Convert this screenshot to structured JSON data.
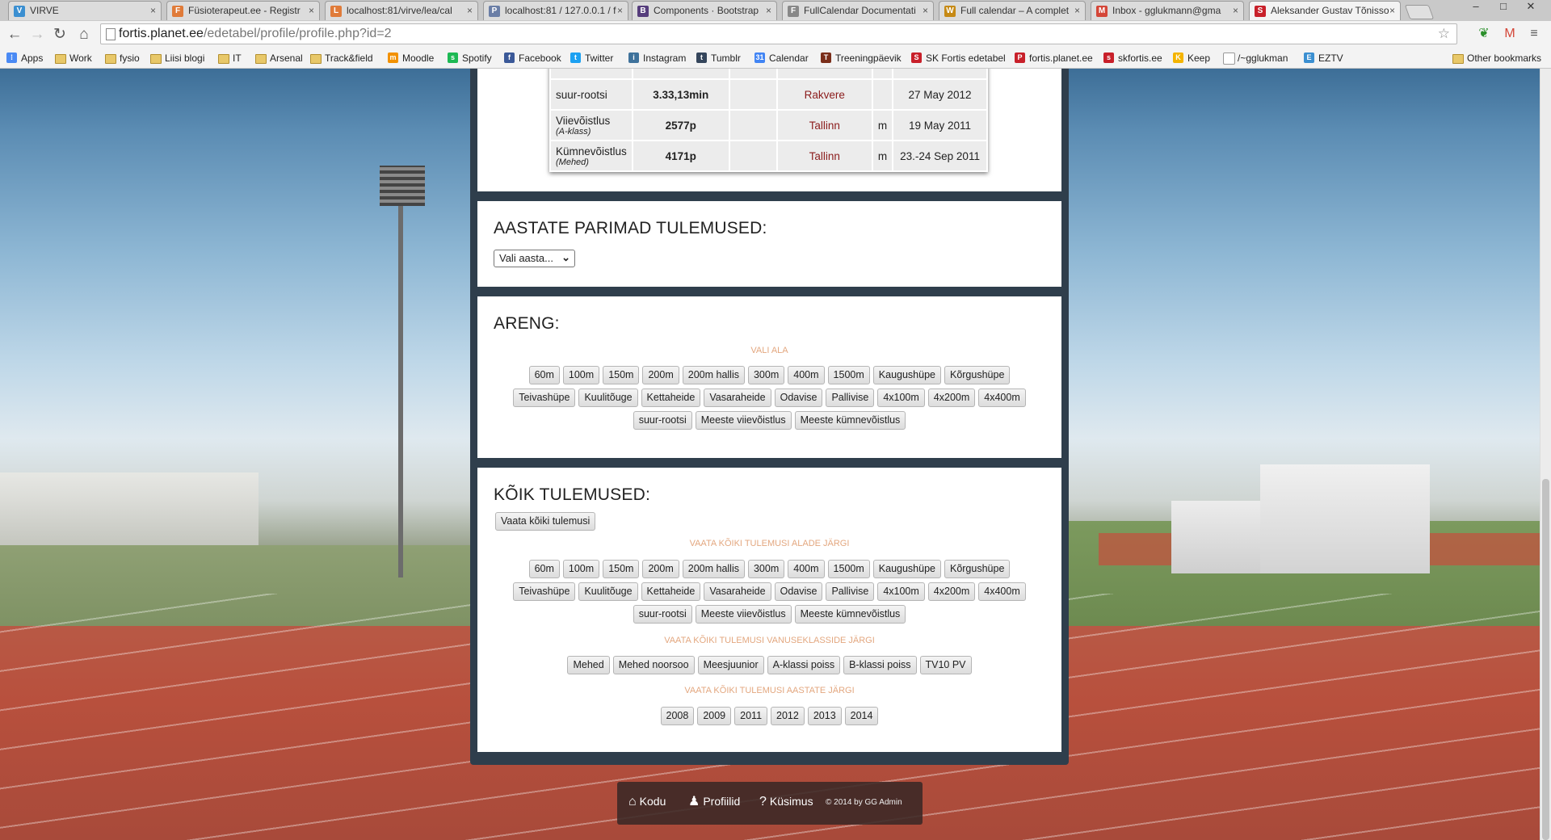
{
  "browser": {
    "tabs": [
      {
        "title": "VIRVE",
        "icon_color": "#3b8fd1",
        "icon": "V",
        "active": false
      },
      {
        "title": "Füsioterapeut.ee - Registr",
        "icon_color": "#e07b39",
        "icon": "F",
        "active": false
      },
      {
        "title": "localhost:81/virve/lea/cal",
        "icon_color": "#e07b39",
        "icon": "L",
        "active": false
      },
      {
        "title": "localhost:81 / 127.0.0.1 / f",
        "icon_color": "#6a7ea6",
        "icon": "P",
        "active": false
      },
      {
        "title": "Components · Bootstrap",
        "icon_color": "#563d7c",
        "icon": "B",
        "active": false
      },
      {
        "title": "FullCalendar Documentati",
        "icon_color": "#888888",
        "icon": "F",
        "active": false
      },
      {
        "title": "Full calendar – A complet",
        "icon_color": "#c68a16",
        "icon": "W",
        "active": false
      },
      {
        "title": "Inbox - gglukmann@gma",
        "icon_color": "#d44638",
        "icon": "M",
        "active": false
      },
      {
        "title": "Aleksander Gustav Tõnisso",
        "icon_color": "#c8202a",
        "icon": "S",
        "active": true
      }
    ],
    "address": {
      "host": "fortis.planet.ee",
      "path": "/edetabel/profile/profile.php?id=2"
    },
    "bookmarks": [
      {
        "label": "Apps",
        "type": "apps"
      },
      {
        "label": "Work",
        "type": "folder"
      },
      {
        "label": "fysio",
        "type": "folder"
      },
      {
        "label": "Liisi blogi",
        "type": "folder"
      },
      {
        "label": "IT",
        "type": "folder"
      },
      {
        "label": "Arsenal",
        "type": "folder"
      },
      {
        "label": "Track&field",
        "type": "folder"
      },
      {
        "label": "Moodle",
        "type": "site",
        "color": "#f29100",
        "icon": "m"
      },
      {
        "label": "Spotify",
        "type": "site",
        "color": "#1db954",
        "icon": "s"
      },
      {
        "label": "Facebook",
        "type": "site",
        "color": "#3b5998",
        "icon": "f"
      },
      {
        "label": "Twitter",
        "type": "site",
        "color": "#1da1f2",
        "icon": "t"
      },
      {
        "label": "Instagram",
        "type": "site",
        "color": "#3f729b",
        "icon": "i"
      },
      {
        "label": "Tumblr",
        "type": "site",
        "color": "#35465c",
        "icon": "t"
      },
      {
        "label": "Calendar",
        "type": "site",
        "color": "#4285f4",
        "icon": "31"
      },
      {
        "label": "Treeningpäevik",
        "type": "site",
        "color": "#7a2e1a",
        "icon": "T"
      },
      {
        "label": "SK Fortis edetabel",
        "type": "site",
        "color": "#c8202a",
        "icon": "S"
      },
      {
        "label": "fortis.planet.ee",
        "type": "site",
        "color": "#c8202a",
        "icon": "P"
      },
      {
        "label": "skfortis.ee",
        "type": "site",
        "color": "#c8202a",
        "icon": "s"
      },
      {
        "label": "Keep",
        "type": "site",
        "color": "#f4b400",
        "icon": "K"
      },
      {
        "label": "/~gglukman",
        "type": "page"
      },
      {
        "label": "EZTV",
        "type": "site",
        "color": "#3b8fd1",
        "icon": "E"
      }
    ],
    "other_bookmarks": "Other bookmarks"
  },
  "results": {
    "rows": [
      {
        "event": "suur-rootsi",
        "sub": "",
        "value": "3.33,13min",
        "place": "Rakvere",
        "m": "",
        "date": "27 May 2012"
      },
      {
        "event": "Viievõistlus",
        "sub": "(A-klass)",
        "value": "2577p",
        "place": "Tallinn",
        "m": "m",
        "date": "19 May 2011"
      },
      {
        "event": "Kümnevõistlus",
        "sub": "(Mehed)",
        "value": "4171p",
        "place": "Tallinn",
        "m": "m",
        "date": "23.-24 Sep 2011"
      }
    ]
  },
  "years_panel": {
    "title": "AASTATE PARIMAD TULEMUSED:",
    "select_value": "Vali aasta..."
  },
  "progress_panel": {
    "title": "ARENG:",
    "label": "VALI ALA",
    "rows": [
      [
        "60m",
        "100m",
        "150m",
        "200m",
        "200m hallis",
        "300m",
        "400m",
        "1500m",
        "Kaugushüpe",
        "Kõrgushüpe"
      ],
      [
        "Teivashüpe",
        "Kuulitõuge",
        "Kettaheide",
        "Vasaraheide",
        "Odavise",
        "Pallivise",
        "4x100m",
        "4x200m",
        "4x400m"
      ],
      [
        "suur-rootsi",
        "Meeste viievõistlus",
        "Meeste kümnevõistlus"
      ]
    ]
  },
  "all_panel": {
    "title": "KÕIK TULEMUSED:",
    "all_button": "Vaata kõiki tulemusi",
    "by_event_label": "VAATA KÕIKI TULEMUSI ALADE JÄRGI",
    "event_rows": [
      [
        "60m",
        "100m",
        "150m",
        "200m",
        "200m hallis",
        "300m",
        "400m",
        "1500m",
        "Kaugushüpe",
        "Kõrgushüpe"
      ],
      [
        "Teivashüpe",
        "Kuulitõuge",
        "Kettaheide",
        "Vasaraheide",
        "Odavise",
        "Pallivise",
        "4x100m",
        "4x200m",
        "4x400m"
      ],
      [
        "suur-rootsi",
        "Meeste viievõistlus",
        "Meeste kümnevõistlus"
      ]
    ],
    "by_age_label": "VAATA KÕIKI TULEMUSI VANUSEKLASSIDE JÄRGI",
    "age_classes": [
      "Mehed",
      "Mehed noorsoo",
      "Meesjuunior",
      "A-klassi poiss",
      "B-klassi poiss",
      "TV10 PV"
    ],
    "by_year_label": "VAATA KÕIKI TULEMUSI AASTATE JÄRGI",
    "years": [
      "2008",
      "2009",
      "2011",
      "2012",
      "2013",
      "2014"
    ]
  },
  "footer": {
    "home": "Kodu",
    "home_icon": "home-icon",
    "profiles": "Profiilid",
    "profiles_icon": "user-icon",
    "faq": "Küsimus",
    "faq_icon": "question-icon",
    "copyright": "© 2014 by GG Admin"
  }
}
